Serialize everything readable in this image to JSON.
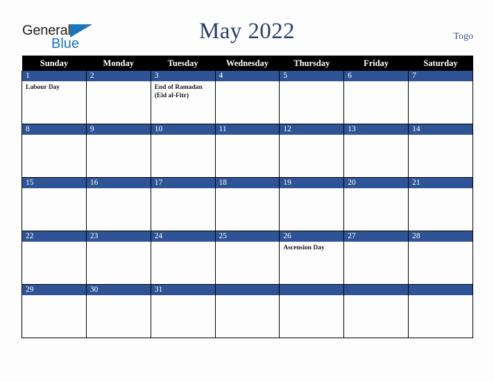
{
  "logo": {
    "word1": "General",
    "word2": "Blue",
    "triangle_color": "#1b75bc",
    "word1_color": "#231f20",
    "word2_color": "#1b75bc"
  },
  "header": {
    "title": "May 2022",
    "region": "Togo",
    "title_color": "#2a3f6b"
  },
  "calendar": {
    "month": "May",
    "year": "2022",
    "weekday_headers": [
      "Sunday",
      "Monday",
      "Tuesday",
      "Wednesday",
      "Thursday",
      "Friday",
      "Saturday"
    ],
    "header_bg": "#000000",
    "daynum_bg": "#2e5496",
    "grid_line_color": "#000000",
    "weeks": [
      [
        {
          "day": "1",
          "event": "Labour Day"
        },
        {
          "day": "2",
          "event": ""
        },
        {
          "day": "3",
          "event": "End of Ramadan (Eid al-Fitr)"
        },
        {
          "day": "4",
          "event": ""
        },
        {
          "day": "5",
          "event": ""
        },
        {
          "day": "6",
          "event": ""
        },
        {
          "day": "7",
          "event": ""
        }
      ],
      [
        {
          "day": "8",
          "event": ""
        },
        {
          "day": "9",
          "event": ""
        },
        {
          "day": "10",
          "event": ""
        },
        {
          "day": "11",
          "event": ""
        },
        {
          "day": "12",
          "event": ""
        },
        {
          "day": "13",
          "event": ""
        },
        {
          "day": "14",
          "event": ""
        }
      ],
      [
        {
          "day": "15",
          "event": ""
        },
        {
          "day": "16",
          "event": ""
        },
        {
          "day": "17",
          "event": ""
        },
        {
          "day": "18",
          "event": ""
        },
        {
          "day": "19",
          "event": ""
        },
        {
          "day": "20",
          "event": ""
        },
        {
          "day": "21",
          "event": ""
        }
      ],
      [
        {
          "day": "22",
          "event": ""
        },
        {
          "day": "23",
          "event": ""
        },
        {
          "day": "24",
          "event": ""
        },
        {
          "day": "25",
          "event": ""
        },
        {
          "day": "26",
          "event": "Ascension Day"
        },
        {
          "day": "27",
          "event": ""
        },
        {
          "day": "28",
          "event": ""
        }
      ],
      [
        {
          "day": "29",
          "event": ""
        },
        {
          "day": "30",
          "event": ""
        },
        {
          "day": "31",
          "event": ""
        },
        {
          "day": "",
          "event": ""
        },
        {
          "day": "",
          "event": ""
        },
        {
          "day": "",
          "event": ""
        },
        {
          "day": "",
          "event": ""
        }
      ]
    ],
    "holidays": [
      {
        "date": "1",
        "name": "Labour Day"
      },
      {
        "date": "3",
        "name": "End of Ramadan (Eid al-Fitr)"
      },
      {
        "date": "26",
        "name": "Ascension Day"
      }
    ]
  }
}
